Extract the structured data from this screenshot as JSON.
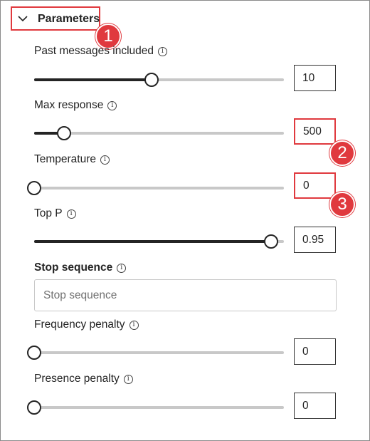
{
  "header": {
    "title": "Parameters"
  },
  "callouts": {
    "one": "1",
    "two": "2",
    "three": "3"
  },
  "params": {
    "past_messages": {
      "label": "Past messages included",
      "value": "10",
      "level": 0.47
    },
    "max_response": {
      "label": "Max response",
      "value": "500",
      "level": 0.12
    },
    "temperature": {
      "label": "Temperature",
      "value": "0",
      "level": 0.0
    },
    "top_p": {
      "label": "Top P",
      "value": "0.95",
      "level": 0.95
    },
    "stop_sequence": {
      "label": "Stop sequence",
      "placeholder": "Stop sequence"
    },
    "frequency_penalty": {
      "label": "Frequency penalty",
      "value": "0",
      "level": 0.0
    },
    "presence_penalty": {
      "label": "Presence penalty",
      "value": "0",
      "level": 0.0
    }
  },
  "colors": {
    "highlight": "#e0393e",
    "slider_active": "#242424",
    "slider_track": "#c8c8c8"
  },
  "icons": {
    "collapse": "chevron-down-icon",
    "info": "info-icon"
  }
}
